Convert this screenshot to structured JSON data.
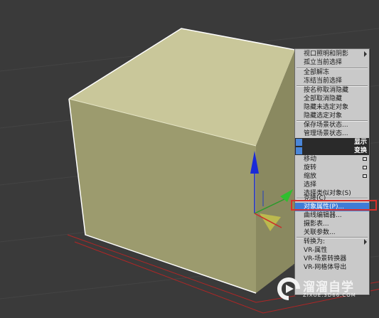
{
  "quad_menu": {
    "items": [
      {
        "label": "视口照明和阴影",
        "submenu": true
      },
      {
        "label": "孤立当前选择"
      },
      {
        "label": "全部解冻"
      },
      {
        "label": "冻结当前选择"
      },
      {
        "label": "按名称取消隐藏"
      },
      {
        "label": "全部取消隐藏"
      },
      {
        "label": "隐藏未选定对象"
      },
      {
        "label": "隐藏选定对象"
      },
      {
        "label": "保存场景状态..."
      },
      {
        "label": "管理场景状态..."
      },
      {
        "label": "移动",
        "options": true
      },
      {
        "label": "旋转",
        "options": true
      },
      {
        "label": "缩放",
        "options": true
      },
      {
        "label": "选择"
      },
      {
        "label": "选择类似对象(S)"
      },
      {
        "label": "克隆(C)"
      },
      {
        "label": "对象属性(P)...",
        "highlighted": true
      },
      {
        "label": "曲线编辑器..."
      },
      {
        "label": "摄影表..."
      },
      {
        "label": "关联参数..."
      },
      {
        "label": "转换为:",
        "submenu": true
      },
      {
        "label": "VR-属性"
      },
      {
        "label": "VR-场景转换器"
      },
      {
        "label": "VR-网格体导出"
      }
    ],
    "quad_titles": {
      "display": "显示",
      "transform": "变换"
    }
  },
  "watermark": {
    "title": "溜溜自学",
    "url": "ZIXUE.3D66.COM"
  },
  "colors": {
    "viewport_bg": "#3a3a3a",
    "box_top": "#c9c79a",
    "box_front": "#9c9b6e",
    "highlight": "#3f7cd6",
    "annotation_red": "#d8302b"
  },
  "icons": [
    "submenu-arrow-icon",
    "options-box-icon",
    "play-logo-icon"
  ]
}
